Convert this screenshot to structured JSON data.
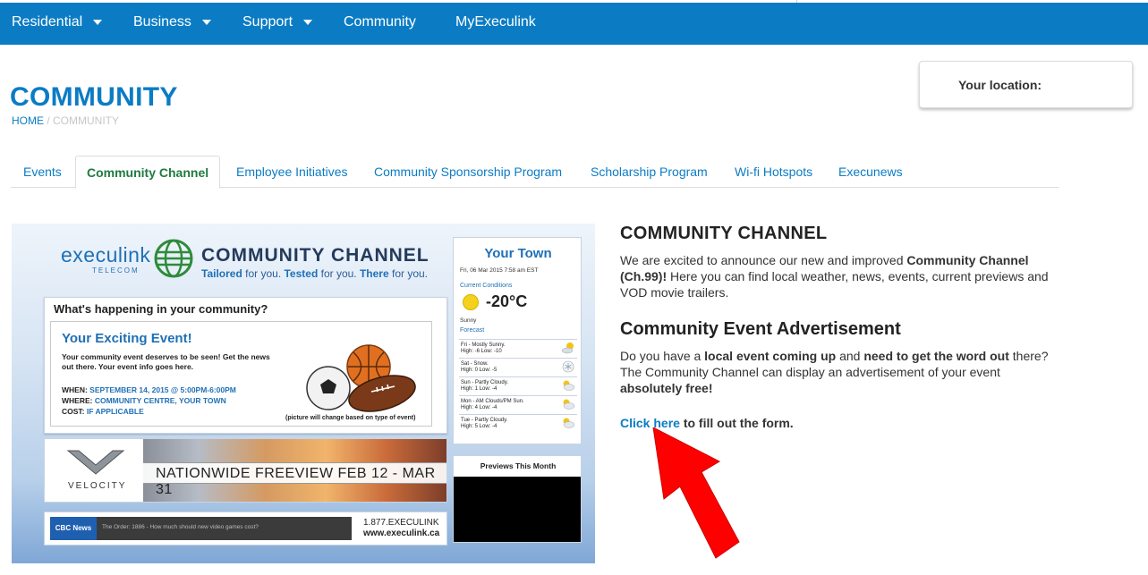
{
  "nav": {
    "items": [
      {
        "label": "Residential",
        "dropdown": true
      },
      {
        "label": "Business",
        "dropdown": true
      },
      {
        "label": "Support",
        "dropdown": true
      },
      {
        "label": "Community",
        "dropdown": false
      },
      {
        "label": "MyExeculink",
        "dropdown": false
      }
    ]
  },
  "page": {
    "title": "COMMUNITY",
    "breadcrumb": {
      "home": "HOME",
      "separator": " / ",
      "current": "COMMUNITY"
    }
  },
  "location": {
    "label": "Your location:"
  },
  "tabs": [
    {
      "label": "Events",
      "active": false
    },
    {
      "label": "Community Channel",
      "active": true
    },
    {
      "label": "Employee Initiatives",
      "active": false
    },
    {
      "label": "Community Sponsorship Program",
      "active": false
    },
    {
      "label": "Scholarship Program",
      "active": false
    },
    {
      "label": "Wi-fi Hotspots",
      "active": false
    },
    {
      "label": "Execunews",
      "active": false
    }
  ],
  "promo": {
    "brand": "execulink",
    "brand_sub": "TELECOM",
    "channel_name": "COMMUNITY CHANNEL",
    "tagline": {
      "a": "Tailored",
      "b": " for you. ",
      "c": "Tested",
      "d": " for you. ",
      "e": "There",
      "f": " for you."
    },
    "whats_happening": "What's happening in your community?",
    "event": {
      "title": "Your Exciting Event!",
      "desc": "Your community event deserves to be seen! Get the news out there. Your event info goes here.",
      "when_label": "WHEN: ",
      "when_value": "SEPTEMBER 14, 2015 @ 5:00PM-6:00PM",
      "where_label": "WHERE: ",
      "where_value": "COMMUNITY CENTRE, YOUR TOWN",
      "cost_label": "COST: ",
      "cost_value": "IF APPLICABLE",
      "note": "(picture will change based on type of event)"
    },
    "velocity": {
      "name": "VELOCITY",
      "banner": "NATIONWIDE FREEVIEW FEB 12 - MAR 31"
    },
    "ticker": {
      "source": "CBC News",
      "headline": "The Order: 1886 - How much should new video games cost?",
      "phone": "1.877.EXECULINK",
      "url": "www.execulink.ca"
    },
    "weather": {
      "town": "Your Town",
      "date": "Fri, 06 Mar 2015 7:58 am EST",
      "current_label": "Current Conditions",
      "temp": "-20°C",
      "condition": "Sunny",
      "forecast_label": "Forecast",
      "forecast": [
        {
          "line1": "Fri - Mostly Sunny.",
          "line2": "High: -6 Low: -10",
          "icon": "partly-sunny-icon"
        },
        {
          "line1": "Sat - Snow.",
          "line2": "High: 0 Low: -5",
          "icon": "snow-icon"
        },
        {
          "line1": "Sun - Partly Cloudy.",
          "line2": "High: 1 Low: -4",
          "icon": "partly-cloudy-icon"
        },
        {
          "line1": "Mon - AM Clouds/PM Sun.",
          "line2": "High: 4 Low: -4",
          "icon": "partly-cloudy-icon"
        },
        {
          "line1": "Tue - Partly Cloudy.",
          "line2": "High: 5 Low: -4",
          "icon": "partly-cloudy-icon"
        }
      ]
    },
    "previews": {
      "label": "Previews This Month"
    }
  },
  "content": {
    "cc_heading": "COMMUNITY CHANNEL",
    "cc_para": {
      "p1": "We are excited to announce our new and improved ",
      "b1": "Community Channel (Ch.99)!",
      "p2": " Here you can find local weather, news, events, current previews and VOD movie trailers."
    },
    "ea_heading": "Community Event Advertisement",
    "ea_para": {
      "p1": "Do you have a ",
      "b1": "local event coming up",
      "p2": " and ",
      "b2": "need to get the word out",
      "p3": " there? The Community Channel can display an advertisement of your event ",
      "b3": "absolutely free!"
    },
    "cta": {
      "link": "Click here",
      "rest": " to fill out the form."
    }
  },
  "colors": {
    "brand": "#0b7cc4",
    "active_tab": "#1e7b3f",
    "arrow": "#ff0000"
  }
}
